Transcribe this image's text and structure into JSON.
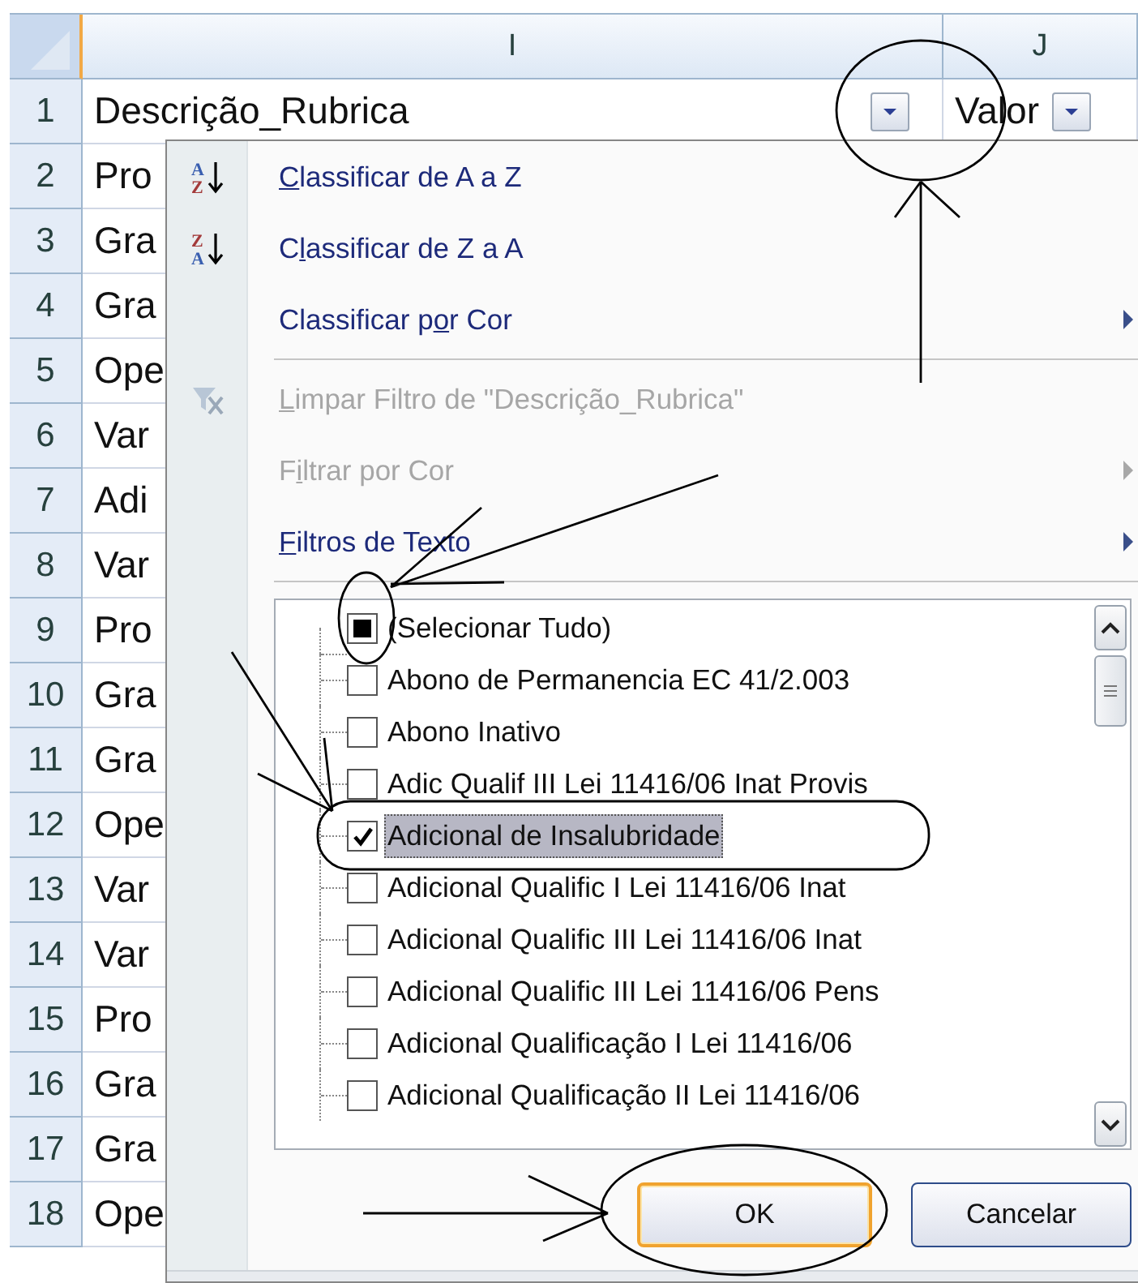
{
  "sheet": {
    "columns": [
      {
        "label": "I"
      },
      {
        "label": "J"
      }
    ],
    "rows": [
      {
        "number": "1",
        "cells": [
          {
            "text": "Descrição_Rubrica",
            "filter": true
          },
          {
            "text": "Valor",
            "filter": true
          }
        ]
      },
      {
        "number": "2",
        "cells": [
          {
            "text": "Pro"
          }
        ]
      },
      {
        "number": "3",
        "cells": [
          {
            "text": "Gra"
          }
        ]
      },
      {
        "number": "4",
        "cells": [
          {
            "text": "Gra"
          }
        ]
      },
      {
        "number": "5",
        "cells": [
          {
            "text": "Ope"
          }
        ]
      },
      {
        "number": "6",
        "cells": [
          {
            "text": "Var"
          }
        ]
      },
      {
        "number": "7",
        "cells": [
          {
            "text": "Adi"
          }
        ]
      },
      {
        "number": "8",
        "cells": [
          {
            "text": "Var"
          }
        ]
      },
      {
        "number": "9",
        "cells": [
          {
            "text": "Pro"
          }
        ]
      },
      {
        "number": "10",
        "cells": [
          {
            "text": "Gra"
          }
        ]
      },
      {
        "number": "11",
        "cells": [
          {
            "text": "Gra"
          }
        ]
      },
      {
        "number": "12",
        "cells": [
          {
            "text": "Ope"
          }
        ]
      },
      {
        "number": "13",
        "cells": [
          {
            "text": "Var"
          }
        ]
      },
      {
        "number": "14",
        "cells": [
          {
            "text": "Var"
          }
        ]
      },
      {
        "number": "15",
        "cells": [
          {
            "text": "Pro"
          }
        ]
      },
      {
        "number": "16",
        "cells": [
          {
            "text": "Gra"
          }
        ]
      },
      {
        "number": "17",
        "cells": [
          {
            "text": "Gra"
          }
        ]
      },
      {
        "number": "18",
        "cells": [
          {
            "text": "Ope"
          }
        ]
      }
    ]
  },
  "filter_menu": {
    "items": [
      {
        "kind": "ascending",
        "icon_letters": [
          "A",
          "Z"
        ],
        "key": "C",
        "after": "lassificar de A a Z",
        "disabled": false,
        "submenu": false
      },
      {
        "kind": "descending",
        "icon_letters": [
          "Z",
          "A"
        ],
        "before": "C",
        "key": "l",
        "after": "assificar de Z a A",
        "disabled": false,
        "submenu": false
      },
      {
        "kind": "command",
        "before": "Classificar p",
        "key": "o",
        "after": "r Cor",
        "disabled": false,
        "submenu": true
      },
      {
        "kind": "separator"
      },
      {
        "kind": "clear",
        "key": "L",
        "after": "impar Filtro de \"Descrição_Rubrica\"",
        "disabled": true,
        "submenu": false
      },
      {
        "kind": "command",
        "before": "F",
        "key": "i",
        "after": "ltrar por Cor",
        "disabled": true,
        "submenu": true
      },
      {
        "kind": "command",
        "key": "F",
        "after": "iltros de Texto",
        "disabled": false,
        "submenu": true
      },
      {
        "kind": "separator"
      }
    ],
    "select_all": {
      "label": "(Selecionar Tudo)",
      "partial": true,
      "selected": false
    },
    "values": [
      {
        "label": "Abono de Permanencia EC 41/2.003",
        "checked": false,
        "selected": false
      },
      {
        "label": "Abono Inativo",
        "checked": false,
        "selected": false
      },
      {
        "label": "Adic Qualif III Lei 11416/06 Inat Provis",
        "checked": false,
        "selected": false
      },
      {
        "label": "Adicional de Insalubridade",
        "checked": true,
        "selected": true
      },
      {
        "label": "Adicional Qualific I Lei 11416/06 Inat",
        "checked": false,
        "selected": false
      },
      {
        "label": "Adicional Qualific III Lei 11416/06 Inat",
        "checked": false,
        "selected": false
      },
      {
        "label": "Adicional Qualific III Lei 11416/06 Pens",
        "checked": false,
        "selected": false
      },
      {
        "label": "Adicional Qualificação I Lei 11416/06",
        "checked": false,
        "selected": false
      },
      {
        "label": "Adicional Qualificação II Lei 11416/06",
        "checked": false,
        "selected": false
      }
    ],
    "buttons": [
      {
        "label": "OK",
        "default": true
      },
      {
        "label": "Cancelar",
        "default": false
      }
    ]
  }
}
